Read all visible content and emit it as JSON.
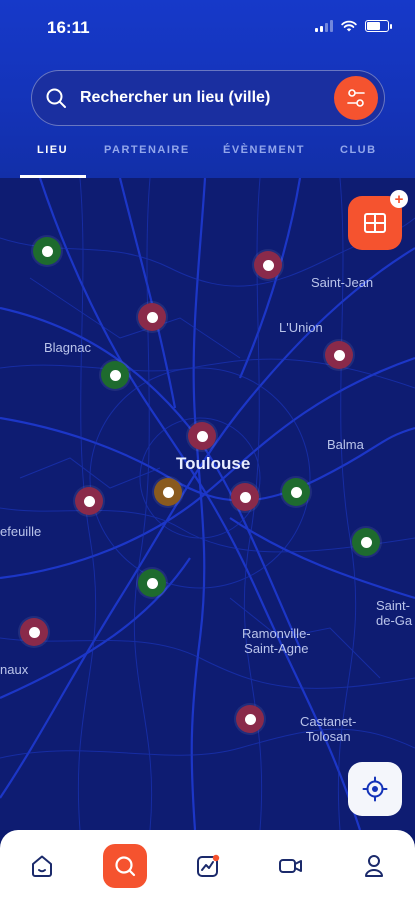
{
  "status_bar": {
    "time": "16:11"
  },
  "search": {
    "placeholder": "Rechercher un lieu (ville)"
  },
  "tabs": [
    {
      "label": "LIEU",
      "active": true
    },
    {
      "label": "PARTENAIRE",
      "active": false
    },
    {
      "label": "ÉVÈNEMENT",
      "active": false
    },
    {
      "label": "CLUB",
      "active": false
    }
  ],
  "map": {
    "labels": {
      "saint_jean": "Saint-Jean",
      "lunion": "L'Union",
      "blagnac": "Blagnac",
      "balma": "Balma",
      "toulouse": "Toulouse",
      "colomiers": "efeuille",
      "saint_orens_1": "Saint-",
      "saint_orens_2": "de-Ga",
      "ramonville_1": "Ramonville-",
      "ramonville_2": "Saint-Agne",
      "portet": "naux",
      "castanet_1": "Castanet-",
      "castanet_2": "Tolosan"
    },
    "pin_colors": {
      "green": "#1e6b2e",
      "red": "#8a2a4a",
      "brown": "#8a5a1e"
    }
  },
  "colors": {
    "accent": "#f5532f",
    "header": "#1433b8",
    "map_bg": "#0e1c72"
  },
  "bottom_nav": {
    "items": [
      "home-icon",
      "search-icon",
      "activity-icon",
      "video-icon",
      "profile-icon"
    ]
  }
}
